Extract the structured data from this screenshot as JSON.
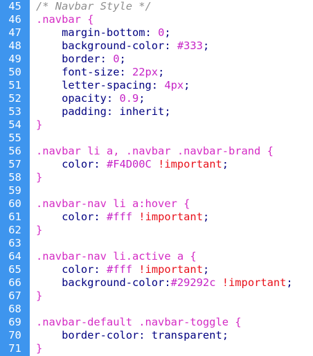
{
  "colors": {
    "gutter_background": "#3e95ee",
    "line_number_text": "#ffffff",
    "comment": "#8f8f8f",
    "selector": "#d42bc4",
    "property": "#000080",
    "number": "#c624c6",
    "important": "#e8101a"
  },
  "editor": {
    "lines": [
      {
        "number": "45",
        "tokens": [
          {
            "type": "comment",
            "text": "/* Navbar Style */"
          }
        ]
      },
      {
        "number": "46",
        "tokens": [
          {
            "type": "selector",
            "text": ".navbar {"
          }
        ]
      },
      {
        "number": "47",
        "tokens": [
          {
            "type": "plain",
            "text": "    margin-bottom: "
          },
          {
            "type": "number",
            "text": "0"
          },
          {
            "type": "plain",
            "text": ";"
          }
        ]
      },
      {
        "number": "48",
        "tokens": [
          {
            "type": "plain",
            "text": "    background-color: "
          },
          {
            "type": "number",
            "text": "#333"
          },
          {
            "type": "plain",
            "text": ";"
          }
        ]
      },
      {
        "number": "49",
        "tokens": [
          {
            "type": "plain",
            "text": "    border: "
          },
          {
            "type": "number",
            "text": "0"
          },
          {
            "type": "plain",
            "text": ";"
          }
        ]
      },
      {
        "number": "50",
        "tokens": [
          {
            "type": "plain",
            "text": "    font-size: "
          },
          {
            "type": "number",
            "text": "22px"
          },
          {
            "type": "plain",
            "text": ";"
          }
        ]
      },
      {
        "number": "51",
        "tokens": [
          {
            "type": "plain",
            "text": "    letter-spacing: "
          },
          {
            "type": "number",
            "text": "4px"
          },
          {
            "type": "plain",
            "text": ";"
          }
        ]
      },
      {
        "number": "52",
        "tokens": [
          {
            "type": "plain",
            "text": "    opacity: "
          },
          {
            "type": "number",
            "text": "0.9"
          },
          {
            "type": "plain",
            "text": ";"
          }
        ]
      },
      {
        "number": "53",
        "tokens": [
          {
            "type": "plain",
            "text": "    padding: inherit;"
          }
        ]
      },
      {
        "number": "54",
        "tokens": [
          {
            "type": "brace",
            "text": "}"
          }
        ]
      },
      {
        "number": "55",
        "tokens": []
      },
      {
        "number": "56",
        "tokens": [
          {
            "type": "selector",
            "text": ".navbar li a, .navbar .navbar-brand {"
          }
        ]
      },
      {
        "number": "57",
        "tokens": [
          {
            "type": "plain",
            "text": "    color: "
          },
          {
            "type": "number",
            "text": "#F4D00C"
          },
          {
            "type": "plain",
            "text": " "
          },
          {
            "type": "important",
            "text": "!important"
          },
          {
            "type": "plain",
            "text": ";"
          }
        ]
      },
      {
        "number": "58",
        "tokens": [
          {
            "type": "brace",
            "text": "}"
          }
        ]
      },
      {
        "number": "59",
        "tokens": []
      },
      {
        "number": "60",
        "tokens": [
          {
            "type": "selector",
            "text": ".navbar-nav li a:hover {"
          }
        ]
      },
      {
        "number": "61",
        "tokens": [
          {
            "type": "plain",
            "text": "    color: "
          },
          {
            "type": "number",
            "text": "#fff"
          },
          {
            "type": "plain",
            "text": " "
          },
          {
            "type": "important",
            "text": "!important"
          },
          {
            "type": "plain",
            "text": ";"
          }
        ]
      },
      {
        "number": "62",
        "tokens": [
          {
            "type": "brace",
            "text": "}"
          }
        ]
      },
      {
        "number": "63",
        "tokens": []
      },
      {
        "number": "64",
        "tokens": [
          {
            "type": "selector",
            "text": ".navbar-nav li.active a {"
          }
        ]
      },
      {
        "number": "65",
        "tokens": [
          {
            "type": "plain",
            "text": "    color: "
          },
          {
            "type": "number",
            "text": "#fff"
          },
          {
            "type": "plain",
            "text": " "
          },
          {
            "type": "important",
            "text": "!important"
          },
          {
            "type": "plain",
            "text": ";"
          }
        ]
      },
      {
        "number": "66",
        "tokens": [
          {
            "type": "plain",
            "text": "    background-color:"
          },
          {
            "type": "number",
            "text": "#29292c"
          },
          {
            "type": "plain",
            "text": " "
          },
          {
            "type": "important",
            "text": "!important"
          },
          {
            "type": "plain",
            "text": ";"
          }
        ]
      },
      {
        "number": "67",
        "tokens": [
          {
            "type": "brace",
            "text": "}"
          }
        ]
      },
      {
        "number": "68",
        "tokens": []
      },
      {
        "number": "69",
        "tokens": [
          {
            "type": "selector",
            "text": ".navbar-default .navbar-toggle {"
          }
        ]
      },
      {
        "number": "70",
        "tokens": [
          {
            "type": "plain",
            "text": "    border-color: transparent;"
          }
        ]
      },
      {
        "number": "71",
        "tokens": [
          {
            "type": "brace",
            "text": "}"
          }
        ]
      }
    ]
  }
}
